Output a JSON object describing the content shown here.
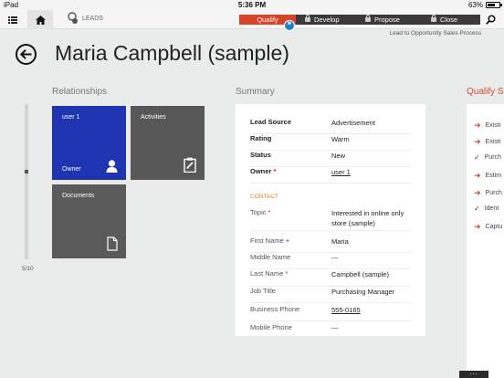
{
  "status_bar": {
    "device": "iPad",
    "time": "5:36 PM",
    "battery": "63%",
    "battery_level": 0.63
  },
  "nav": {
    "entity_label": "LEADS"
  },
  "process": {
    "stages": [
      {
        "label": "Qualify",
        "active": true
      },
      {
        "label": "Develop",
        "active": false
      },
      {
        "label": "Propose",
        "active": false
      },
      {
        "label": "Close",
        "active": false
      }
    ],
    "flag_icon": "flag-icon",
    "name": "Lead to Opportunity Sales Process"
  },
  "header": {
    "title": "Maria Campbell (sample)"
  },
  "sections": {
    "relationships": "Relationships",
    "summary": "Summary",
    "qualify": "Qualify St"
  },
  "relationships": {
    "page_indicator": "5/10",
    "tiles": [
      {
        "label": "user 1",
        "sub": "Owner",
        "icon": "person-icon",
        "color": "#1f34b0"
      },
      {
        "label": "Activities",
        "sub": "",
        "icon": "clipboard-icon",
        "color": "#575757"
      },
      {
        "label": "Documents",
        "sub": "",
        "icon": "document-icon",
        "color": "#5a5a5a"
      }
    ]
  },
  "summary": {
    "top_fields": [
      {
        "label": "Lead Source",
        "value": "Advertisement"
      },
      {
        "label": "Rating",
        "value": "Warm"
      },
      {
        "label": "Status",
        "value": "New"
      },
      {
        "label": "Owner",
        "value": "user 1"
      }
    ],
    "contact_header": "CONTACT",
    "contact_fields": [
      {
        "label": "Topic",
        "value": "Interested in online only store (sample)"
      },
      {
        "label": "First Name",
        "value": "Maria"
      },
      {
        "label": "Middle Name",
        "value": "---"
      },
      {
        "label": "Last Name",
        "value": "Campbell (sample)"
      },
      {
        "label": "Job Title",
        "value": "Purchasing Manager"
      },
      {
        "label": "Business Phone",
        "value": "555-0165"
      },
      {
        "label": "Mobile Phone",
        "value": "---"
      }
    ],
    "required_mark": "*",
    "recommended_mark": "+"
  },
  "qualify_items": [
    {
      "text": "Existi",
      "state": "arrow"
    },
    {
      "text": "Existi",
      "state": "arrow"
    },
    {
      "text": "Purch",
      "state": "check"
    },
    {
      "text": "Estim",
      "state": "arrow"
    },
    {
      "text": "Purch",
      "state": "arrow"
    },
    {
      "text": "Ident",
      "state": "check"
    },
    {
      "text": "Captu",
      "state": "arrow"
    }
  ],
  "bottom": {
    "more": "..."
  },
  "colors": {
    "accent": "#d7422a",
    "tile_blue": "#1f34b0",
    "link_blue": "#1e7fc2"
  }
}
